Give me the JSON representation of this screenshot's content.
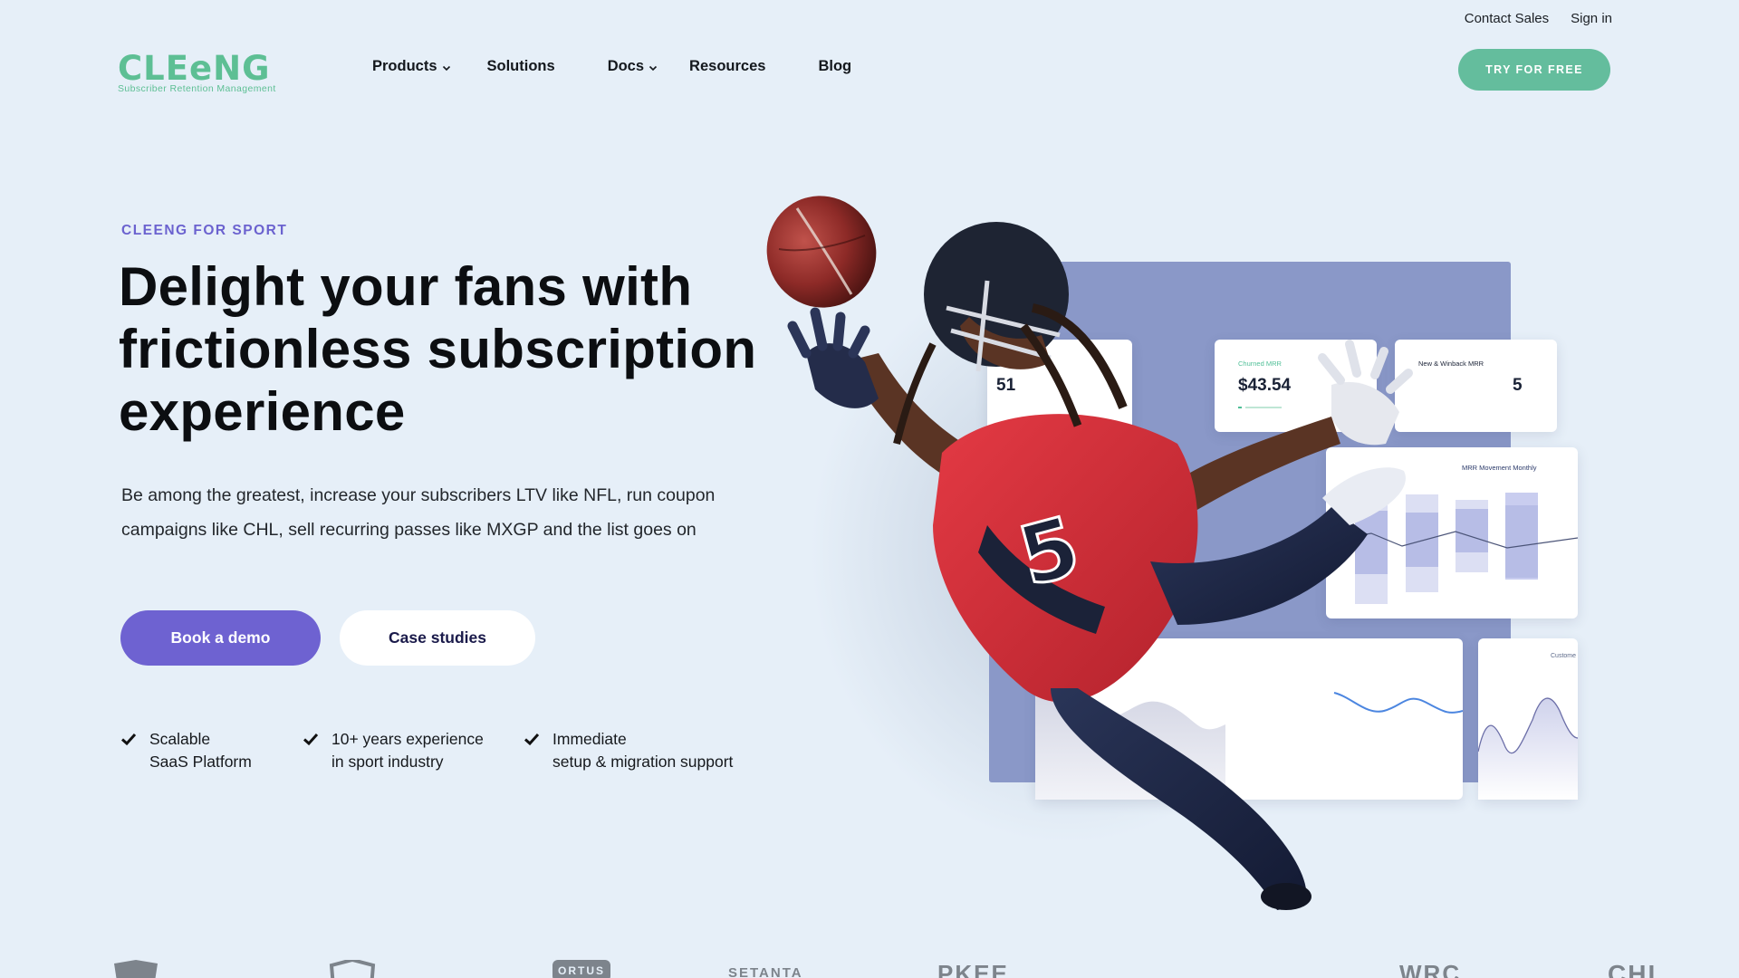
{
  "utility": {
    "contact": "Contact Sales",
    "signin": "Sign in"
  },
  "logo": {
    "word": "CLEeNG",
    "tagline": "Subscriber Retention Management"
  },
  "nav": {
    "products": "Products",
    "solutions": "Solutions",
    "docs": "Docs",
    "resources": "Resources",
    "blog": "Blog"
  },
  "cta_top": "TRY FOR FREE",
  "hero": {
    "eyebrow": "CLEENG FOR SPORT",
    "headline_1": "Delight your fans with",
    "headline_2": "frictionless subscription",
    "headline_3": "experience",
    "lead_1": "Be among the greatest, increase your subscribers LTV like NFL, run coupon",
    "lead_2": "campaigns like CHL, sell recurring passes like MXGP and the list goes on",
    "btn_demo": "Book a demo",
    "btn_case": "Case studies"
  },
  "features": [
    {
      "line1": "Scalable",
      "line2": "SaaS Platform"
    },
    {
      "line1": "10+ years experience",
      "line2": "in sport industry"
    },
    {
      "line1": "Immediate",
      "line2": "setup & migration support"
    }
  ],
  "dashboard": {
    "card1_value": "51",
    "card2_label": "Churned MRR",
    "card2_value": "$43.54",
    "card3_label": "New & Winback MRR",
    "card3_value": "5",
    "card4_label": "MRR Movement Monthly",
    "card6_label": "Custome"
  },
  "partners": [
    "ORTUS",
    "SETANTA",
    "PKEE",
    "WRC",
    "CHL"
  ],
  "colors": {
    "background": "#e6eff8",
    "brand_green": "#5dbf94",
    "accent_purple": "#6e62d1",
    "cta_green": "#64bd9d"
  },
  "icons": [
    "chevron-down-icon",
    "check-icon",
    "shield-logo-icon"
  ]
}
